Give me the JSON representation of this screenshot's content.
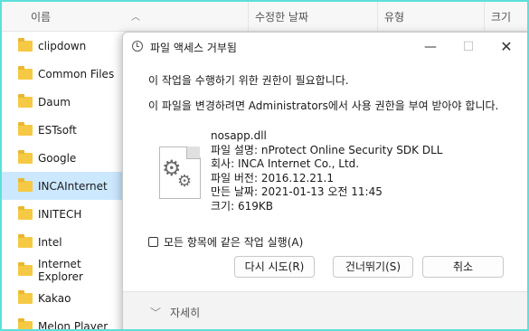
{
  "explorer": {
    "columns": {
      "name": "이름",
      "modified": "수정한 날짜",
      "type": "유형",
      "size": "크기"
    },
    "folders": [
      "clipdown",
      "Common Files",
      "Daum",
      "ESTsoft",
      "Google",
      "INCAInternet",
      "INITECH",
      "Intel",
      "Internet Explorer",
      "Kakao",
      "Melon Player"
    ],
    "selected": "INCAInternet"
  },
  "dialog": {
    "title": "파일 액세스 거부됨",
    "message1": "이 작업을 수행하기 위한 권한이 필요합니다.",
    "message2": "이 파일을 변경하려면 Administrators에서 사용 권한을 부여 받아야 합니다.",
    "file": {
      "name": "nosapp.dll",
      "description": "파일 설명: nProtect Online Security SDK DLL",
      "company": "회사: INCA Internet Co., Ltd.",
      "version": "파일 버전: 2016.12.21.1",
      "date": "만든 날짜: 2021-01-13 오전 11:45",
      "size": "크기: 619KB"
    },
    "checkbox_label": "모든 항목에 같은 작업 실행(A)",
    "buttons": {
      "retry": "다시 시도(R)",
      "skip": "건너뛰기(S)",
      "cancel": "취소"
    },
    "details": "자세히",
    "icons": {
      "title": "clock-icon",
      "file": "file-gear-icon"
    }
  }
}
